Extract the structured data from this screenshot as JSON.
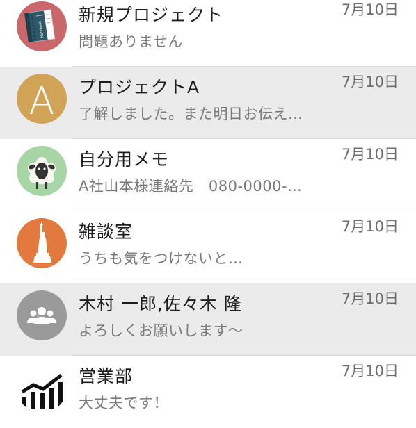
{
  "conversations": [
    {
      "title": "新規プロジェクト",
      "preview": "問題ありません",
      "date": "7月10日",
      "avatar_icon": "notebook-icon",
      "avatar_text": "NoteBook",
      "avatar_color": "#c9676a",
      "highlighted": false
    },
    {
      "title": "プロジェクトA",
      "preview": "了解しました。また明日お伝え…",
      "date": "7月10日",
      "avatar_icon": "letter-a-icon",
      "avatar_text": "A",
      "avatar_color": "#d1a357",
      "highlighted": true
    },
    {
      "title": "自分用メモ",
      "preview": "A社山本様連絡先　080-0000-…",
      "date": "7月10日",
      "avatar_icon": "sheep-icon",
      "avatar_color": "#a8d5a6",
      "highlighted": false
    },
    {
      "title": "雑談室",
      "preview": "うちも気をつけないと…",
      "date": "7月10日",
      "avatar_icon": "statue-of-liberty-icon",
      "avatar_color": "#e27a3d",
      "highlighted": false
    },
    {
      "title": "木村 一郎,佐々木 隆",
      "preview": "よろしくお願いします〜",
      "date": "7月10日",
      "avatar_icon": "group-icon",
      "avatar_color": "#9a9a9a",
      "highlighted": true
    },
    {
      "title": "営業部",
      "preview": "大丈夫です！",
      "date": "7月10日",
      "avatar_icon": "bar-chart-icon",
      "avatar_color": "#ffffff",
      "highlighted": false
    }
  ]
}
